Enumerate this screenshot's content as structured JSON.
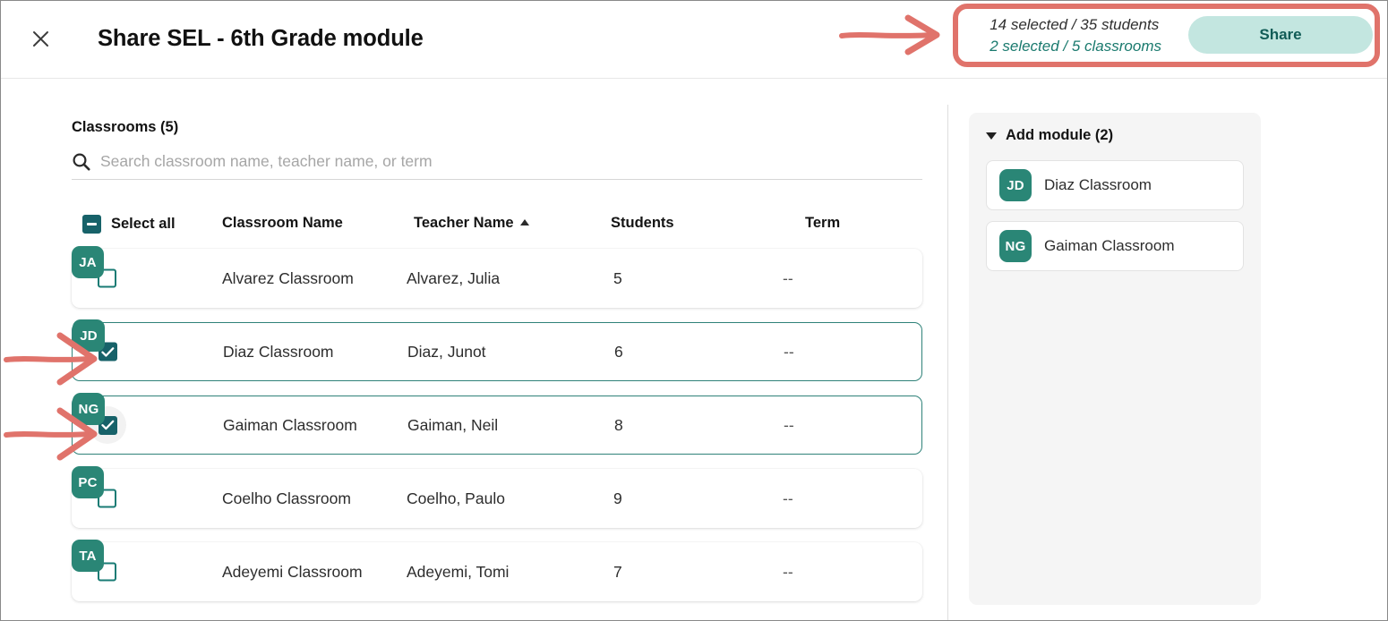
{
  "header": {
    "close_icon": "close-icon",
    "title": "Share SEL - 6th Grade module",
    "counts": {
      "students_line": "14 selected / 35 students",
      "classrooms_line": "2 selected / 5 classrooms"
    },
    "share_label": "Share"
  },
  "left": {
    "section_title": "Classrooms (5)",
    "search": {
      "icon": "search-icon",
      "placeholder": "Search classroom name, teacher name, or term",
      "value": ""
    },
    "columns": {
      "select_all": "Select all",
      "classroom_name": "Classroom Name",
      "teacher_name": "Teacher Name",
      "students": "Students",
      "term": "Term"
    },
    "sort": {
      "column": "Teacher Name",
      "direction": "asc",
      "icon": "sort-ascending-icon"
    },
    "select_all_state": "indeterminate",
    "rows": [
      {
        "initials": "JA",
        "classroom": "Alvarez Classroom",
        "teacher": "Alvarez, Julia",
        "students": "5",
        "term": "--",
        "selected": false,
        "hover": false
      },
      {
        "initials": "JD",
        "classroom": "Diaz Classroom",
        "teacher": "Diaz, Junot",
        "students": "6",
        "term": "--",
        "selected": true,
        "hover": false
      },
      {
        "initials": "NG",
        "classroom": "Gaiman Classroom",
        "teacher": "Gaiman, Neil",
        "students": "8",
        "term": "--",
        "selected": true,
        "hover": true
      },
      {
        "initials": "PC",
        "classroom": "Coelho Classroom",
        "teacher": "Coelho, Paulo",
        "students": "9",
        "term": "--",
        "selected": false,
        "hover": false
      },
      {
        "initials": "TA",
        "classroom": "Adeyemi Classroom",
        "teacher": "Adeyemi, Tomi",
        "students": "7",
        "term": "--",
        "selected": false,
        "hover": false
      }
    ]
  },
  "right_panel": {
    "header_label": "Add module (2)",
    "caret_icon": "chevron-down-icon",
    "chips": [
      {
        "initials": "JD",
        "label": "Diaz Classroom"
      },
      {
        "initials": "NG",
        "label": "Gaiman Classroom"
      }
    ]
  },
  "annotations": {
    "box_color": "#e0736b",
    "arrow_color": "#e0736b",
    "arrows": [
      "arrow-to-share-summary",
      "arrow-to-diaz-checkbox",
      "arrow-to-gaiman-checkbox"
    ]
  },
  "colors": {
    "teal_avatar": "#2a8676",
    "teal_checkbox": "#176269",
    "teal_border": "#2f8279",
    "share_bg": "#c3e6e0",
    "share_text": "#115c57",
    "annotation_red": "#e0736b"
  }
}
